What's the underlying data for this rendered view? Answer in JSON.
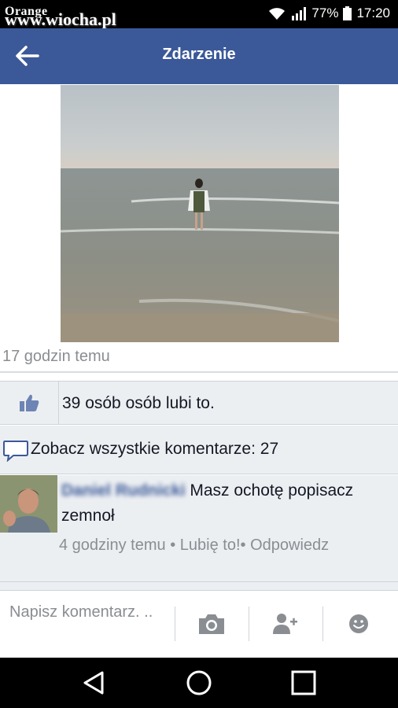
{
  "status_bar": {
    "carrier": "Orange",
    "watermark": "www.wiocha.pl",
    "battery": "77%",
    "time": "17:20"
  },
  "app_bar": {
    "title": "Zdarzenie",
    "back_icon": "arrow-left-icon"
  },
  "post": {
    "photo_description": "beach-photo",
    "timestamp": "17 godzin temu"
  },
  "likes": {
    "icon": "thumbs-up-icon",
    "text": "39 osób osób lubi to."
  },
  "comments_link": {
    "icon": "comment-bubble-icon",
    "text": "Zobacz wszystkie komentarze: 27"
  },
  "comment": {
    "author": "Daniel Rudnicki",
    "text": "Masz ochotę popisacz zemnoł",
    "time": "4 godziny temu",
    "like_link": "Lubię to!",
    "reply_link": "Odpowiedz",
    "separator": "•"
  },
  "composer": {
    "placeholder": "Napisz komentarz. ..",
    "icons": [
      "camera-icon",
      "add-friend-icon",
      "emoji-icon"
    ]
  },
  "nav_bar": {
    "icons": [
      "back-triangle-icon",
      "home-circle-icon",
      "recents-square-icon"
    ]
  },
  "colors": {
    "brand": "#3b5998",
    "background_gray": "#eceff2",
    "muted_text": "#8a8d91"
  }
}
